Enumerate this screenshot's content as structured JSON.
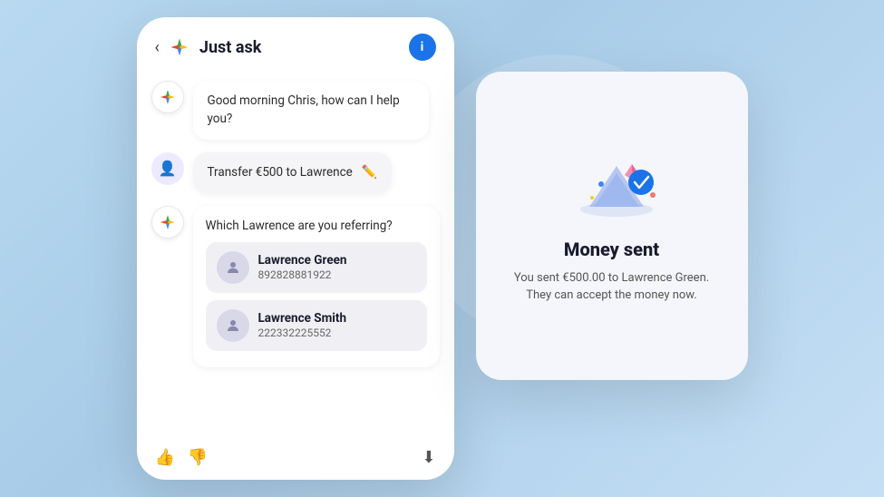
{
  "header": {
    "back_label": "‹",
    "title": "Just ask",
    "info_label": "i"
  },
  "chat": {
    "greeting": "Good morning Chris, how can I help you?",
    "user_message": "Transfer €500 to Lawrence",
    "bot_question": "Which Lawrence are you referring?",
    "contacts": [
      {
        "name": "Lawrence Green",
        "number": "892828881922"
      },
      {
        "name": "Lawrence Smith",
        "number": "222332225552"
      }
    ]
  },
  "actions": {
    "thumbup": "👍",
    "thumbdown": "👎",
    "download": "⬇"
  },
  "card": {
    "title": "Money sent",
    "description": "You sent €500.00 to Lawrence Green. They can accept the money now."
  }
}
